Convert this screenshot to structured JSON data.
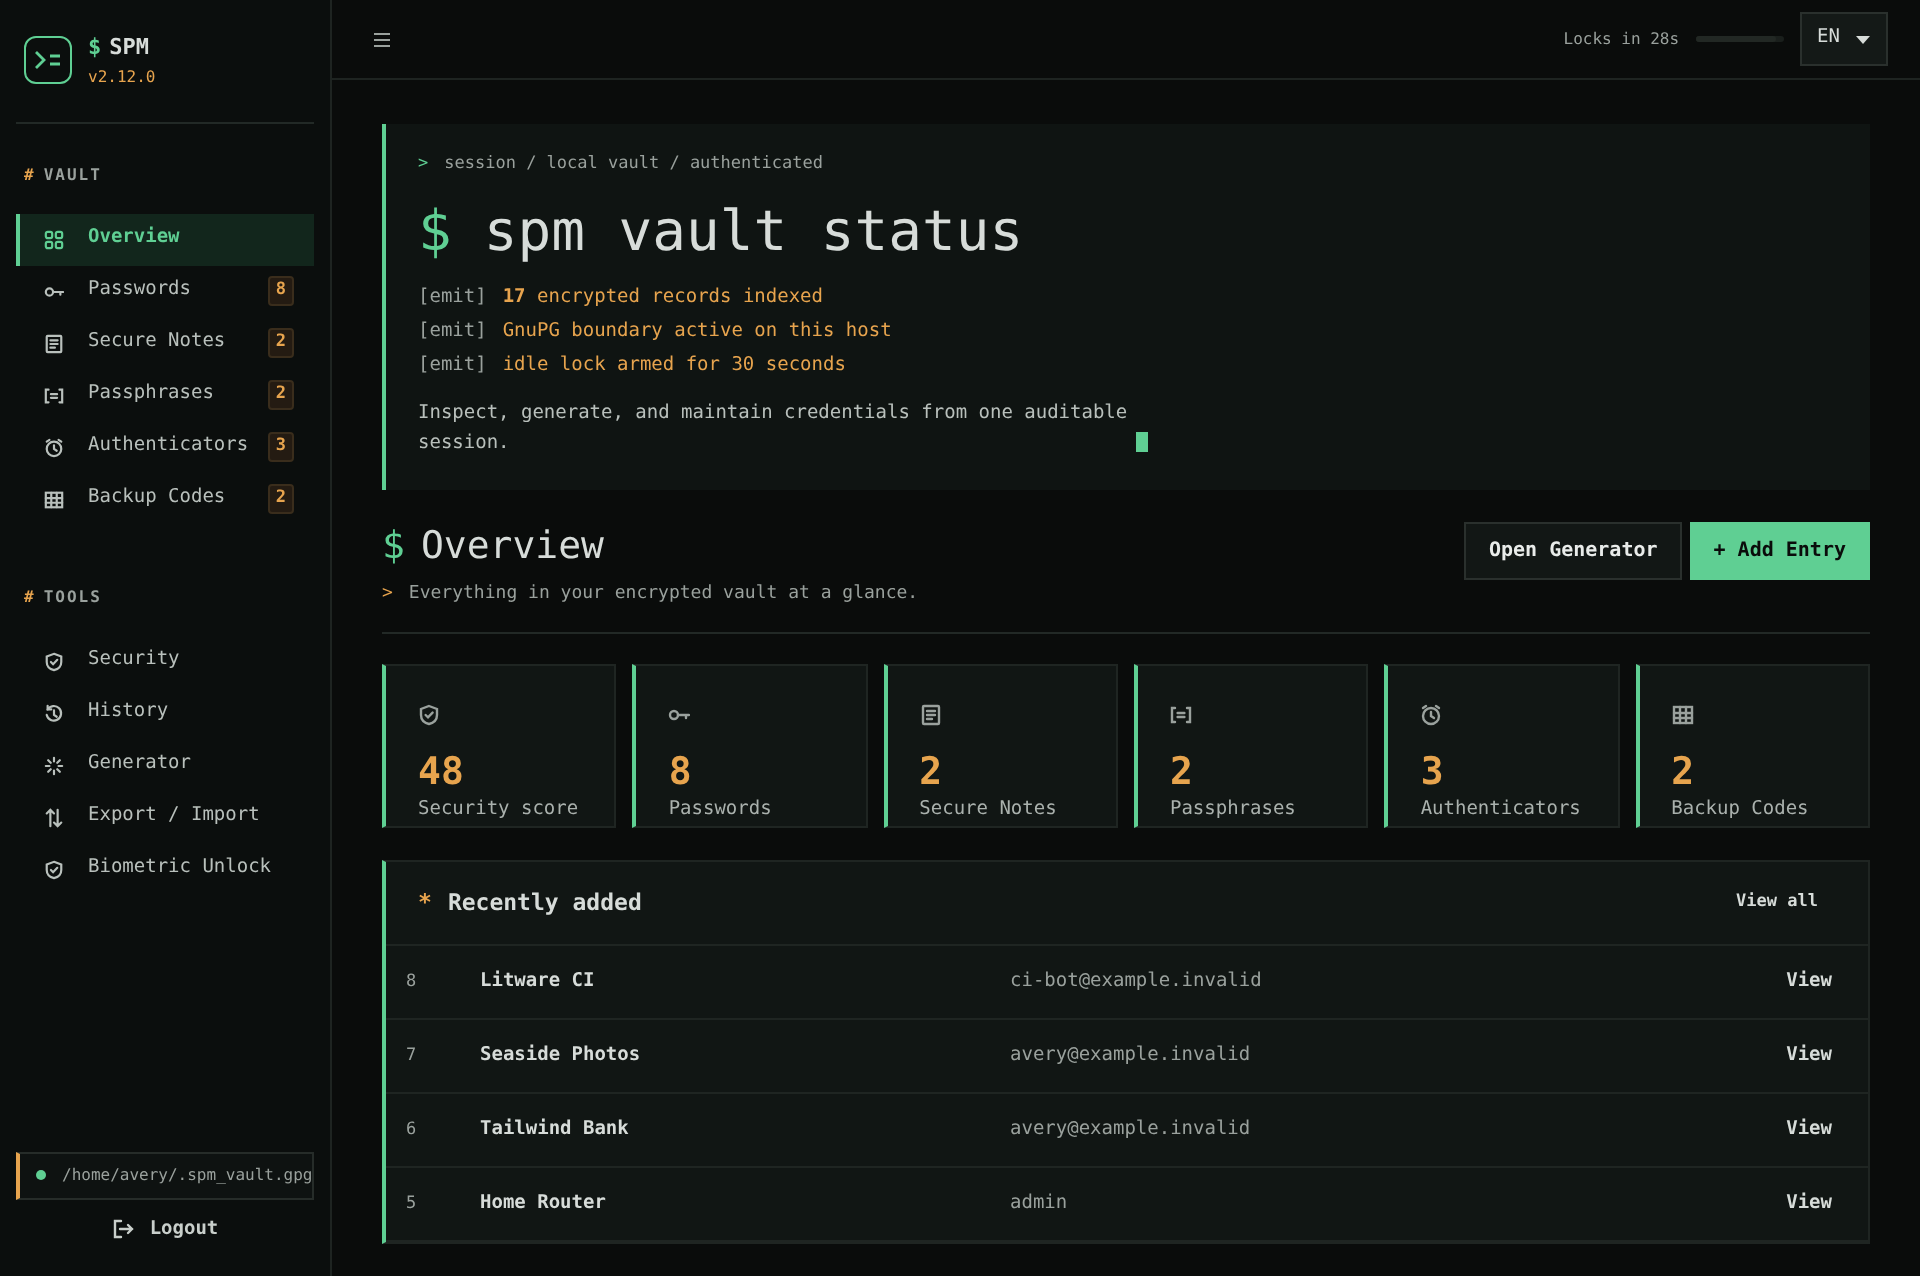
{
  "brand": {
    "prompt": "$",
    "name": "SPM",
    "version": "v2.12.0"
  },
  "sidebar": {
    "sections": [
      {
        "marker": "#",
        "heading": "VAULT",
        "items": [
          {
            "label": "Overview",
            "selected": true
          },
          {
            "label": "Passwords",
            "count": "8",
            "selected": false
          },
          {
            "label": "Secure Notes",
            "count": "2",
            "selected": false
          },
          {
            "label": "Passphrases",
            "count": "2",
            "selected": false
          },
          {
            "label": "Authenticators",
            "count": "3",
            "selected": false
          },
          {
            "label": "Backup Codes",
            "count": "2",
            "selected": false
          }
        ]
      },
      {
        "marker": "#",
        "heading": "TOOLS",
        "items": [
          {
            "label": "Security",
            "selected": false
          },
          {
            "label": "History",
            "selected": false
          },
          {
            "label": "Generator",
            "selected": false
          },
          {
            "label": "Export / Import",
            "selected": false
          },
          {
            "label": "Biometric Unlock",
            "selected": false
          }
        ]
      }
    ],
    "vault_path": "/home/avery/.spm_vault.gpg",
    "logout": "Logout"
  },
  "topbar": {
    "lock_label": "Locks in 28s",
    "lock": {
      "level": 0.93
    },
    "language": "EN"
  },
  "hero": {
    "breadcrumb_prompt": ">",
    "breadcrumb": "session / local vault / authenticated",
    "title_prompt": "$",
    "title": "spm vault status",
    "log": [
      {
        "tag": "[emit]",
        "text": "**17** encrypted records indexed"
      },
      {
        "tag": "[emit]",
        "text": "GnuPG boundary active on this host"
      },
      {
        "tag": "[emit]",
        "text": "idle lock armed for 30 seconds"
      }
    ],
    "description": "Inspect, generate, and maintain credentials from one auditable session."
  },
  "page_header": {
    "prompt": "$",
    "title": "Overview",
    "subtitle_prompt": ">",
    "subtitle": "Everything in your encrypted vault at a glance.",
    "buttons": [
      {
        "label": "Open Generator",
        "kind": "secondary"
      },
      {
        "label": "+ Add Entry",
        "kind": "primary"
      }
    ]
  },
  "stats": [
    {
      "value": "48",
      "label": "Security score"
    },
    {
      "value": "8",
      "label": "Passwords"
    },
    {
      "value": "2",
      "label": "Secure Notes"
    },
    {
      "value": "2",
      "label": "Passphrases"
    },
    {
      "value": "3",
      "label": "Authenticators"
    },
    {
      "value": "2",
      "label": "Backup Codes"
    }
  ],
  "recent": {
    "marker": "*",
    "title": "Recently added",
    "view_all": "View all",
    "rows": [
      {
        "index": "8",
        "name": "Litware CI",
        "account": "ci-bot@example.invalid",
        "action": "View"
      },
      {
        "index": "7",
        "name": "Seaside Photos",
        "account": "avery@example.invalid",
        "action": "View"
      },
      {
        "index": "6",
        "name": "Tailwind Bank",
        "account": "avery@example.invalid",
        "action": "View"
      },
      {
        "index": "5",
        "name": "Home Router",
        "account": "admin",
        "action": "View"
      }
    ]
  }
}
